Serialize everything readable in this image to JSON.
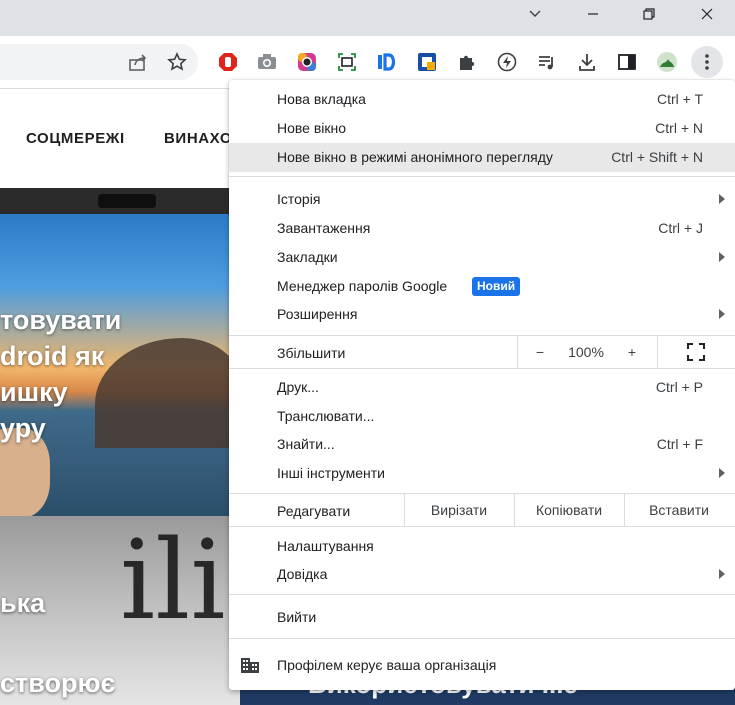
{
  "page": {
    "nav": [
      "СОЦМЕРЕЖІ",
      "ВИНАХО"
    ],
    "hero_lines": [
      "товувати",
      "droid як",
      "ишку",
      "уру"
    ],
    "card2_line1": "ька",
    "card2_big": "ilid",
    "card2_line2": "створює",
    "card3_text": "Використовувати ...е"
  },
  "menu": {
    "group1": [
      {
        "label": "Нова вкладка",
        "shortcut": "Ctrl + T"
      },
      {
        "label": "Нове вікно",
        "shortcut": "Ctrl + N"
      },
      {
        "label": "Нове вікно в режимі анонімного перегляду",
        "shortcut": "Ctrl + Shift + N"
      }
    ],
    "group2": [
      {
        "label": "Історія",
        "shortcut": ""
      },
      {
        "label": "Завантаження",
        "shortcut": "Ctrl + J"
      },
      {
        "label": "Закладки",
        "shortcut": ""
      },
      {
        "label": "Менеджер паролів Google",
        "shortcut": ""
      },
      {
        "label": "Розширення",
        "shortcut": ""
      }
    ],
    "new_badge": "Новий",
    "zoom": {
      "label": "Збільшити",
      "minus": "−",
      "value": "100%",
      "plus": "+"
    },
    "group3": [
      {
        "label": "Друк...",
        "shortcut": "Ctrl + P"
      },
      {
        "label": "Транслювати...",
        "shortcut": ""
      },
      {
        "label": "Знайти...",
        "shortcut": "Ctrl + F"
      },
      {
        "label": "Інші інструменти",
        "shortcut": ""
      }
    ],
    "edit": {
      "label": "Редагувати",
      "cut": "Вирізати",
      "copy": "Копіювати",
      "paste": "Вставити"
    },
    "group4": [
      {
        "label": "Налаштування"
      },
      {
        "label": "Довідка"
      }
    ],
    "exit": "Вийти",
    "managed": "Профілем керує ваша організація"
  },
  "colors": {
    "accent": "#1a73e8",
    "highlight": "#e8e8e9",
    "titlebar": "#dee1e6"
  },
  "icons": [
    "chevron-down-icon",
    "minimize-icon",
    "restore-icon",
    "close-icon",
    "share-icon",
    "bookmark-star-icon",
    "adblock-icon",
    "camera-icon",
    "color-picker-icon",
    "screenshot-icon",
    "id-extension-icon",
    "lock-extension-icon",
    "puzzle-icon",
    "bolt-icon",
    "playlist-icon",
    "download-icon",
    "sidepanel-icon",
    "profile-avatar-icon",
    "kebab-menu-icon",
    "fullscreen-icon",
    "building-icon"
  ]
}
